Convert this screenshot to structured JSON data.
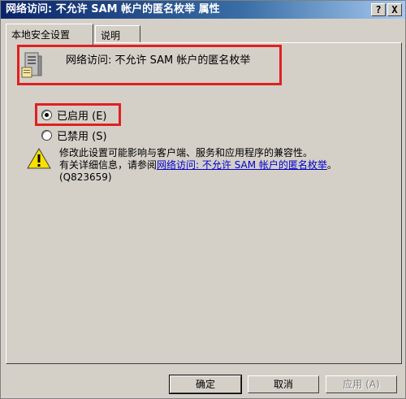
{
  "window": {
    "title": "网络访问: 不允许 SAM 帐户的匿名枚举 属性",
    "help_glyph": "?",
    "close_glyph": "X"
  },
  "tabs": [
    {
      "label": "本地安全设置",
      "active": true
    },
    {
      "label": "说明",
      "active": false
    }
  ],
  "policy": {
    "icon": "server-policy-icon",
    "name": "网络访问: 不允许 SAM 帐户的匿名枚举"
  },
  "options": {
    "enabled_label": "已启用 (E)",
    "disabled_label": "已禁用 (S)",
    "selected": "enabled"
  },
  "warning": {
    "icon": "warning-icon",
    "line1": "修改此设置可能影响与客户端、服务和应用程序的兼容性。",
    "line2_prefix": "有关详细信息，请参阅",
    "link_text": "网络访问: 不允许 SAM 帐户的匿名枚举",
    "suffix": "。 (Q823659)"
  },
  "buttons": {
    "ok": "确定",
    "cancel": "取消",
    "apply": "应用 (A)"
  },
  "colors": {
    "highlight": "#e02020",
    "dialog_bg": "#d4d0c8",
    "title_start": "#0a246a",
    "link": "#0000cc"
  }
}
